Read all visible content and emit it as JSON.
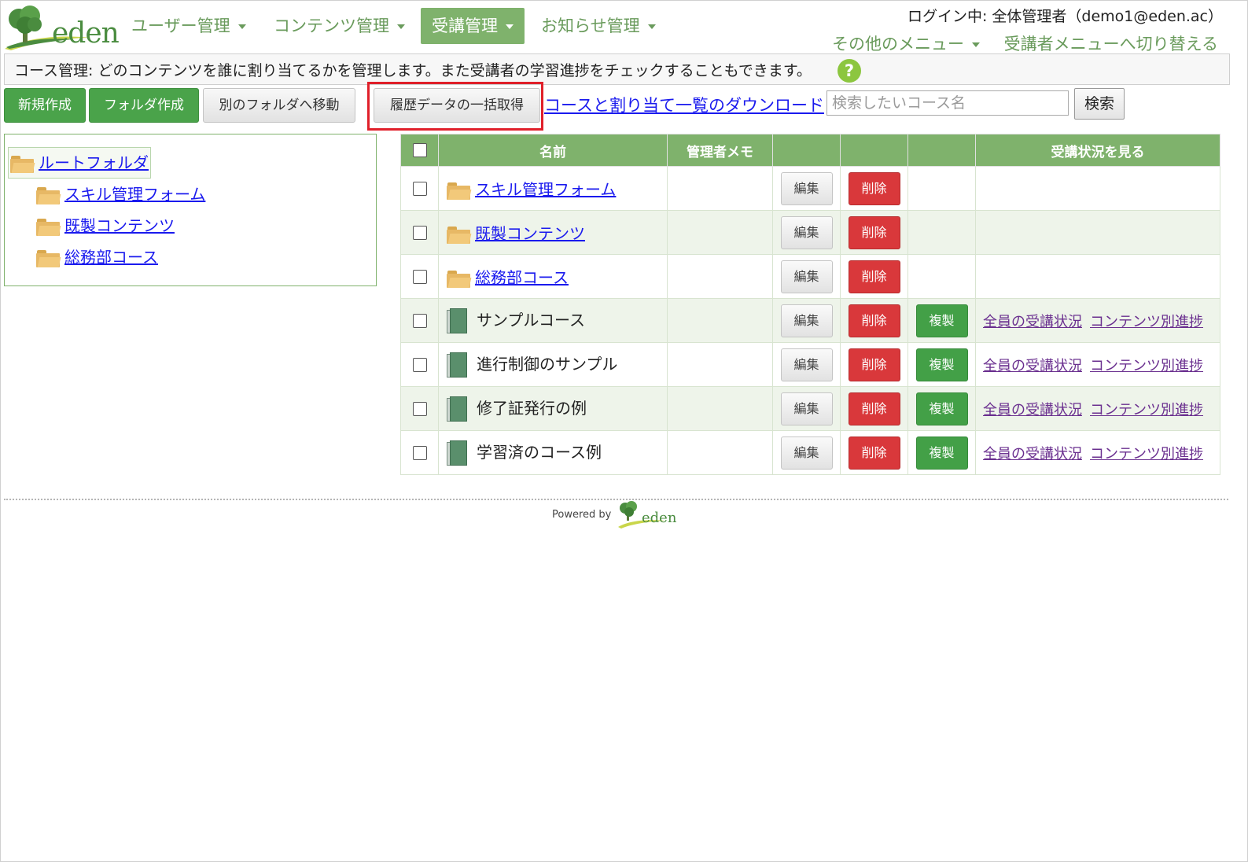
{
  "logo": {
    "text": "eden"
  },
  "nav": [
    {
      "label": "ユーザー管理",
      "active": false
    },
    {
      "label": "コンテンツ管理",
      "active": false
    },
    {
      "label": "受講管理",
      "active": true
    },
    {
      "label": "お知らせ管理",
      "active": false
    }
  ],
  "header": {
    "login_text": "ログイン中: 全体管理者（demo1@eden.ac）",
    "other_menu": "その他のメニュー",
    "switch_menu": "受講者メニューへ切り替える"
  },
  "info": {
    "text": "コース管理: どのコンテンツを誰に割り当てるかを管理します。また受講者の学習進捗をチェックすることもできます。",
    "help_icon": "?"
  },
  "toolbar": {
    "new_label": "新規作成",
    "folder_label": "フォルダ作成",
    "move_label": "別のフォルダへ移動",
    "history_label": "履歴データの一括取得",
    "download_label": "コースと割り当て一覧のダウンロード",
    "search_placeholder": "検索したいコース名",
    "search_label": "検索"
  },
  "tree": {
    "root": "ルートフォルダ",
    "children": [
      "スキル管理フォーム",
      "既製コンテンツ",
      "総務部コース"
    ]
  },
  "table": {
    "headers": {
      "name": "名前",
      "memo": "管理者メモ",
      "status": "受講状況を見る"
    },
    "edit_label": "編集",
    "delete_label": "削除",
    "duplicate_label": "複製",
    "all_status_label": "全員の受講状況",
    "content_progress_label": "コンテンツ別進捗",
    "rows": [
      {
        "type": "folder",
        "name": "スキル管理フォーム"
      },
      {
        "type": "folder",
        "name": "既製コンテンツ"
      },
      {
        "type": "folder",
        "name": "総務部コース"
      },
      {
        "type": "course",
        "name": "サンプルコース"
      },
      {
        "type": "course",
        "name": "進行制御のサンプル"
      },
      {
        "type": "course",
        "name": "修了証発行の例"
      },
      {
        "type": "course",
        "name": "学習済のコース例"
      }
    ]
  },
  "footer": {
    "powered_by": "Powered by",
    "logo_text": "eden"
  },
  "colors": {
    "accent_green": "#7fb26c",
    "button_green": "#4aa34a",
    "delete_red": "#d9383b",
    "highlight_red": "#e0202a",
    "link_blue": "#1a1aee",
    "visited_purple": "#6a2f8f"
  },
  "icons": {
    "logo": "tree-logo-icon",
    "folder": "folder-icon",
    "course": "book-icon",
    "help": "help-icon",
    "nav_dropdown": "caret-down-icon"
  }
}
